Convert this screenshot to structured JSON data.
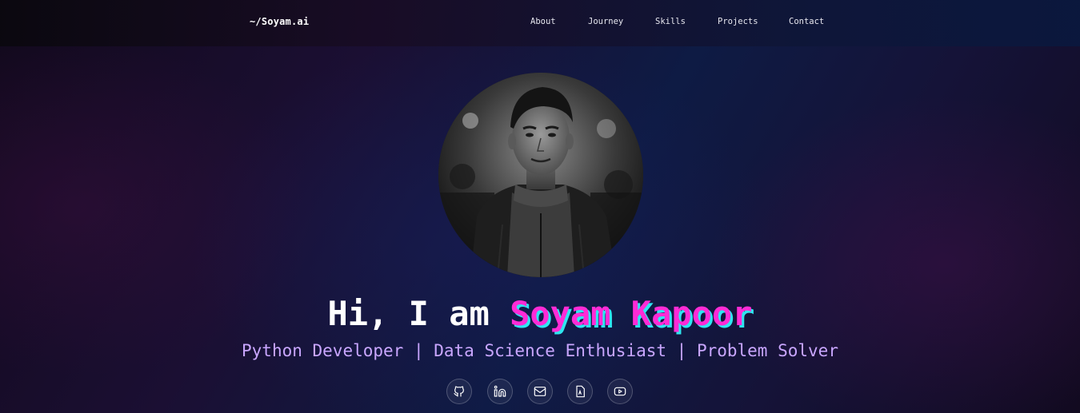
{
  "nav": {
    "brand": "~/Soyam.ai",
    "links": [
      {
        "label": "About"
      },
      {
        "label": "Journey"
      },
      {
        "label": "Skills"
      },
      {
        "label": "Projects"
      },
      {
        "label": "Contact"
      }
    ]
  },
  "hero": {
    "greeting": "Hi, I am ",
    "name": "Soyam Kapoor",
    "tagline": "Python Developer | Data Science Enthusiast | Problem Solver",
    "name_color": "#ff2bd6",
    "name_shadow_color": "#2ee6f0",
    "tagline_color": "#c9a6ff"
  },
  "socials": [
    {
      "icon": "github-icon"
    },
    {
      "icon": "linkedin-icon"
    },
    {
      "icon": "mail-icon"
    },
    {
      "icon": "resume-icon"
    },
    {
      "icon": "youtube-icon"
    }
  ]
}
